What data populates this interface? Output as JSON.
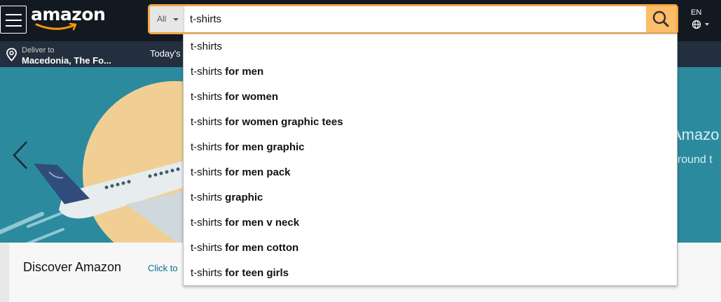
{
  "header": {
    "logo_text": "amazon",
    "search": {
      "department": "All",
      "query": "t-shirts"
    },
    "language": "EN"
  },
  "subbar": {
    "deliver_label": "Deliver to",
    "deliver_location": "Macedonia, The Fo...",
    "nav_item": "Today's"
  },
  "hero": {
    "text_line1": "Amazo",
    "text_line2": "around t"
  },
  "discover": {
    "title": "Discover Amazon",
    "link": "Click to"
  },
  "suggestions": [
    {
      "prefix": "t-shirts",
      "suffix": ""
    },
    {
      "prefix": "t-shirts",
      "suffix": " for men"
    },
    {
      "prefix": "t-shirts",
      "suffix": " for women"
    },
    {
      "prefix": "t-shirts",
      "suffix": " for women graphic tees"
    },
    {
      "prefix": "t-shirts",
      "suffix": " for men graphic"
    },
    {
      "prefix": "t-shirts",
      "suffix": " for men pack"
    },
    {
      "prefix": "t-shirts",
      "suffix": " graphic"
    },
    {
      "prefix": "t-shirts",
      "suffix": " for men v neck"
    },
    {
      "prefix": "t-shirts",
      "suffix": " for men cotton"
    },
    {
      "prefix": "t-shirts",
      "suffix": " for teen girls"
    }
  ],
  "colors": {
    "header_bg": "#131921",
    "subbar_bg": "#232f3e",
    "search_border": "#f3a847",
    "search_button": "#febd69",
    "hero_bg": "#2b8a9e",
    "link": "#007185"
  },
  "icons": {
    "menu": "hamburger-icon",
    "search": "magnifier-icon",
    "location": "location-pin-icon",
    "language": "globe-icon",
    "carousel_prev": "chevron-left-icon"
  }
}
